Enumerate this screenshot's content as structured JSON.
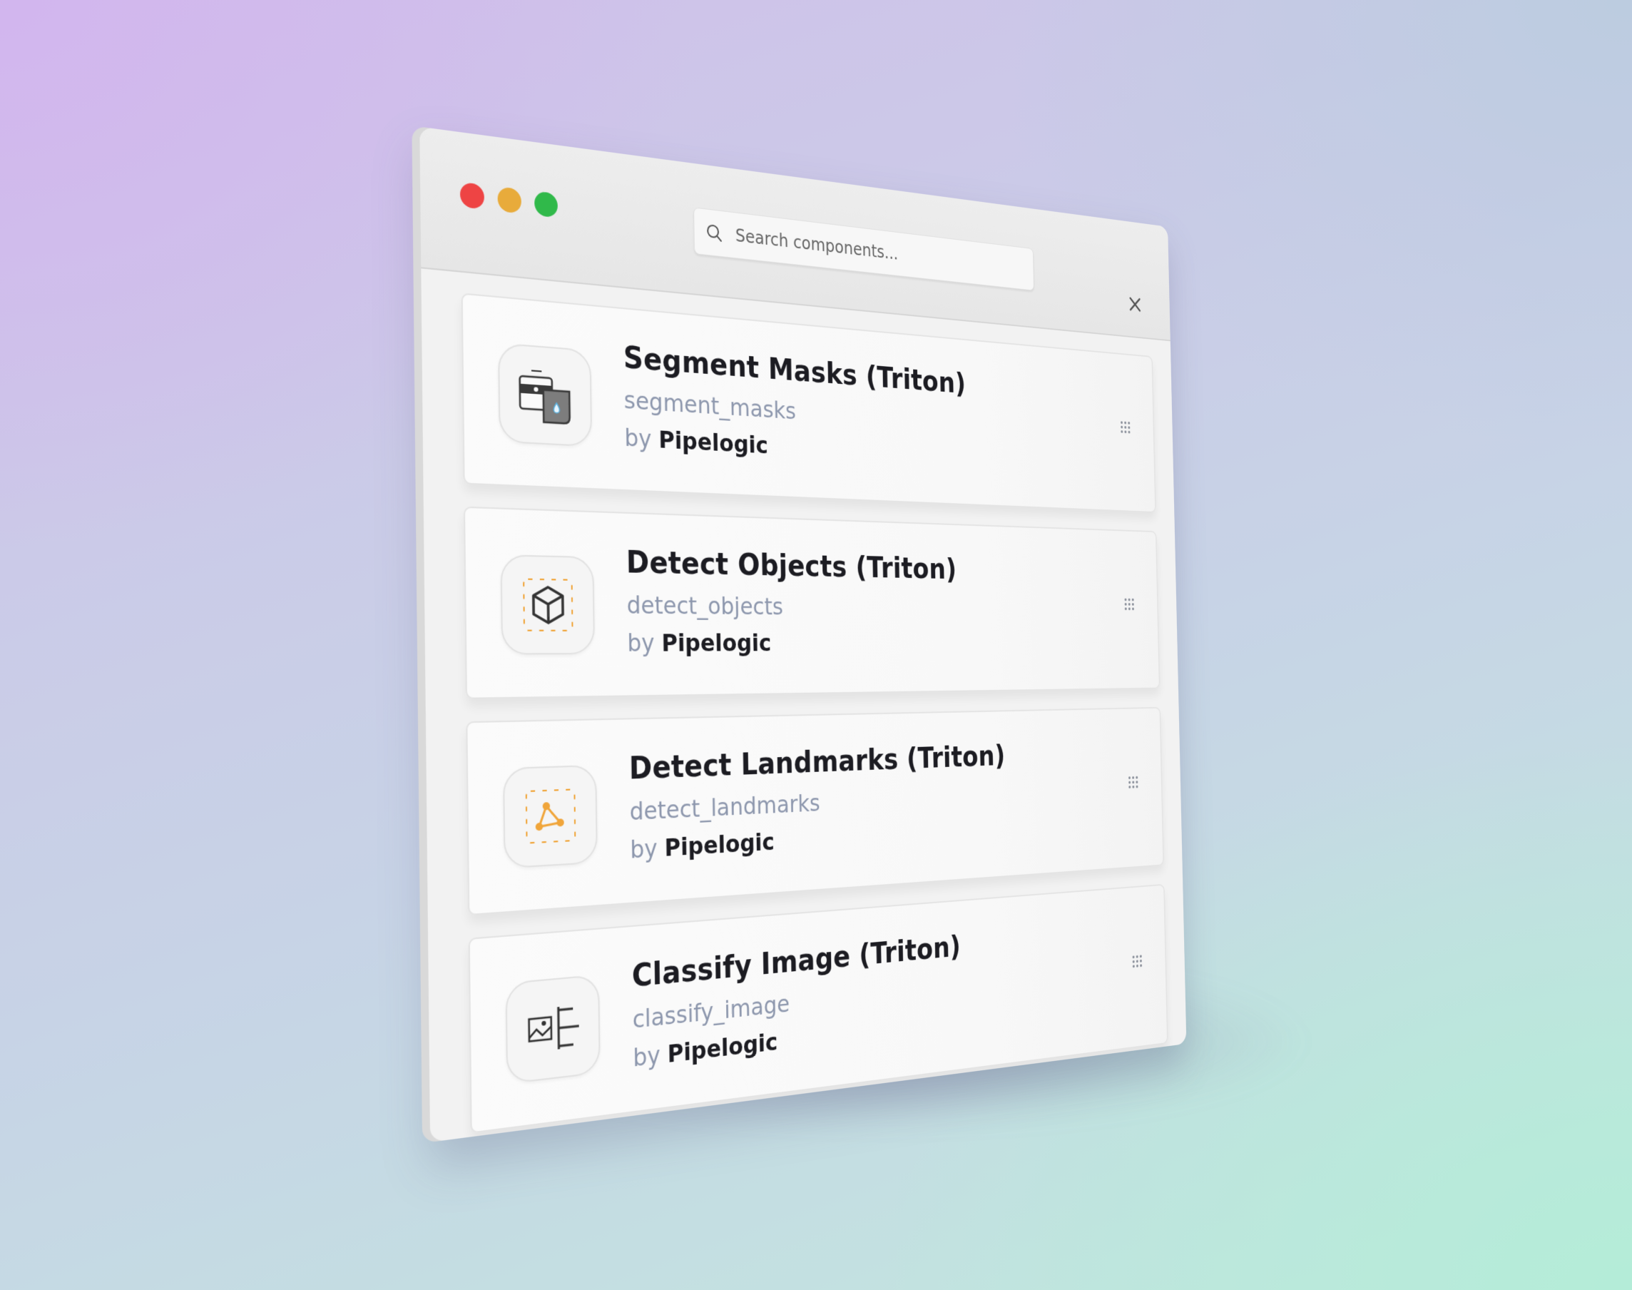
{
  "window": {
    "controls": {
      "close_color": "#ee4444",
      "minimize_color": "#e8ab3b",
      "zoom_color": "#30b94a"
    }
  },
  "search": {
    "placeholder": "Search components...",
    "icon": "search-icon"
  },
  "close_button": {
    "icon": "close-icon"
  },
  "components": [
    {
      "title": "Segment Masks (Triton)",
      "slug": "segment_masks",
      "by_label": "by",
      "author": "Pipelogic",
      "icon": "segment-masks-icon"
    },
    {
      "title": "Detect Objects (Triton)",
      "slug": "detect_objects",
      "by_label": "by",
      "author": "Pipelogic",
      "icon": "cube-icon"
    },
    {
      "title": "Detect Landmarks (Triton)",
      "slug": "detect_landmarks",
      "by_label": "by",
      "author": "Pipelogic",
      "icon": "landmarks-icon"
    },
    {
      "title": "Classify Image (Triton)",
      "slug": "classify_image",
      "by_label": "by",
      "author": "Pipelogic",
      "icon": "classify-image-icon"
    }
  ],
  "colors": {
    "title": "#1c1c22",
    "secondary": "#8d97ad",
    "accent_orange": "#f0a53a"
  }
}
